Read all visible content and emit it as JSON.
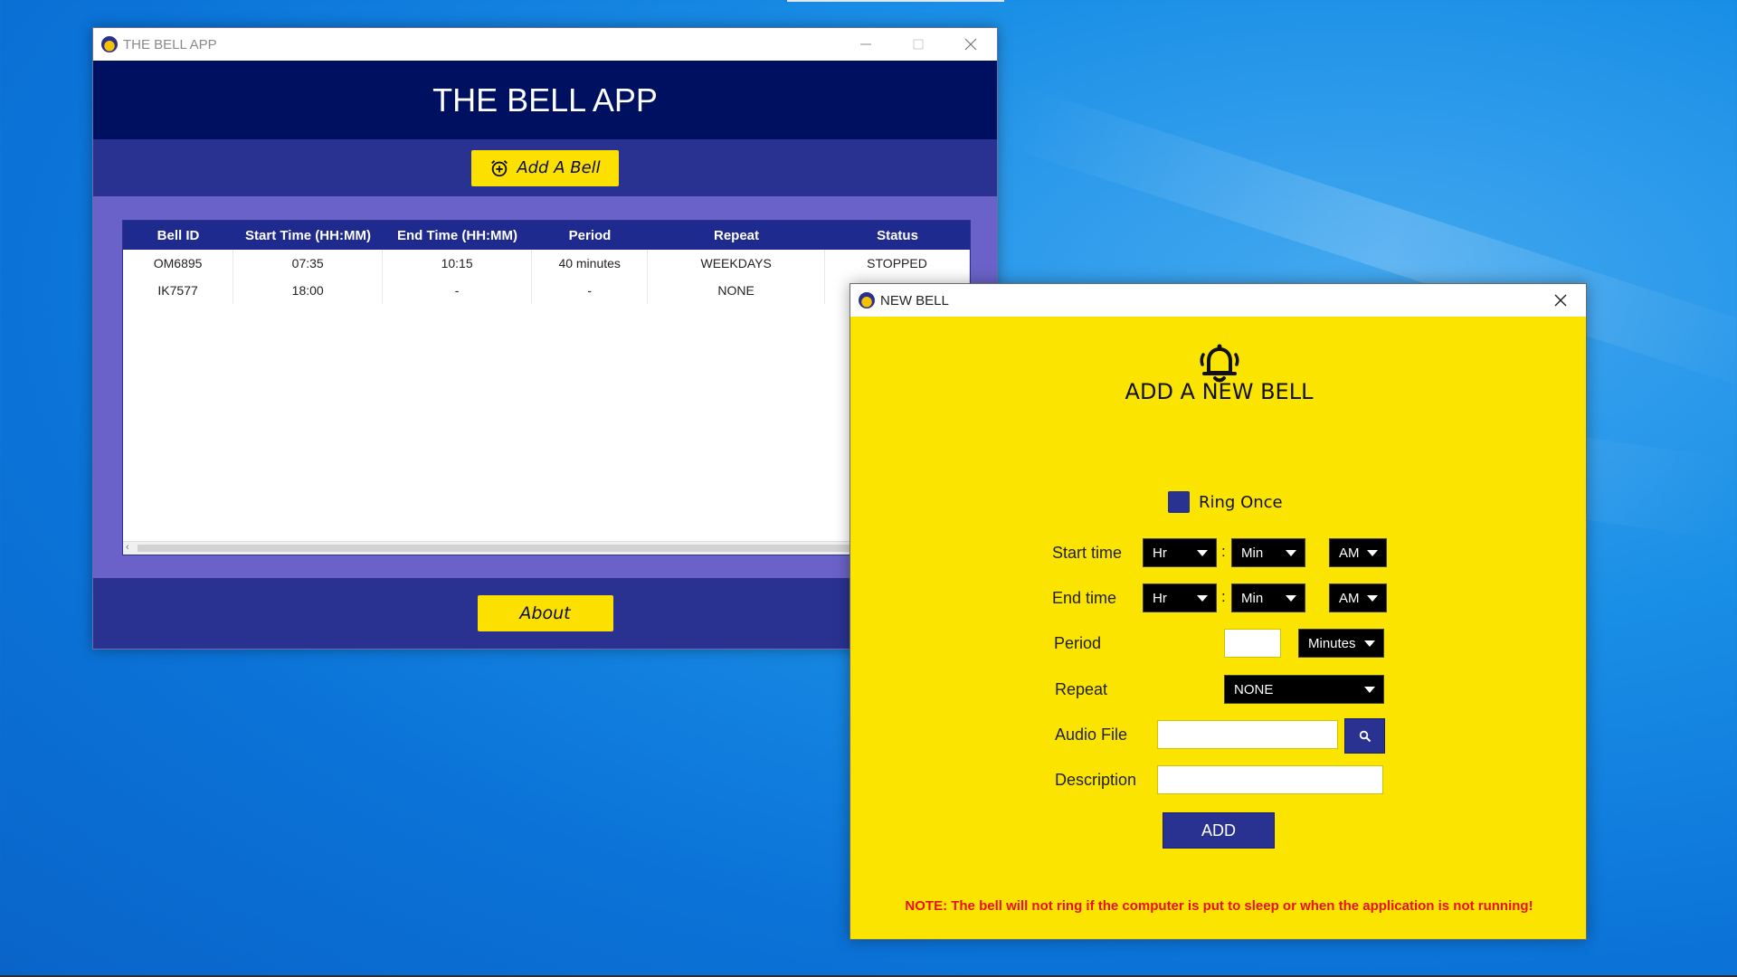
{
  "main_window": {
    "title": "THE BELL APP",
    "header": "THE BELL APP",
    "add_bell_label": "Add A Bell",
    "about_label": "About",
    "table": {
      "columns": [
        "Bell ID",
        "Start Time (HH:MM)",
        "End Time (HH:MM)",
        "Period",
        "Repeat",
        "Status"
      ],
      "rows": [
        [
          "OM6895",
          "07:35",
          "10:15",
          "40 minutes",
          "WEEKDAYS",
          "STOPPED"
        ],
        [
          "IK7577",
          "18:00",
          "-",
          "-",
          "NONE",
          ""
        ]
      ]
    }
  },
  "dialog": {
    "title": "NEW BELL",
    "heading": "ADD A NEW BELL",
    "ring_once_label": "Ring Once",
    "start_time_label": "Start time",
    "end_time_label": "End time",
    "period_label": "Period",
    "repeat_label": "Repeat",
    "audio_file_label": "Audio File",
    "description_label": "Description",
    "start_hr": "Hr",
    "start_min": "Min",
    "start_ampm": "AM",
    "end_hr": "Hr",
    "end_min": "Min",
    "end_ampm": "AM",
    "colon": ":",
    "period_value": "",
    "period_unit": "Minutes",
    "repeat_value": "NONE",
    "audio_file_value": "",
    "description_value": "",
    "add_label": "ADD",
    "note": "NOTE: The bell will not ring if the computer is put to sleep or when the application is not running!"
  },
  "colors": {
    "header_navy": "#001060",
    "bar_blue": "#2a3291",
    "table_bg_purple": "#6a62c8",
    "accent_yellow": "#fbe000",
    "note_red": "#e8121b"
  }
}
